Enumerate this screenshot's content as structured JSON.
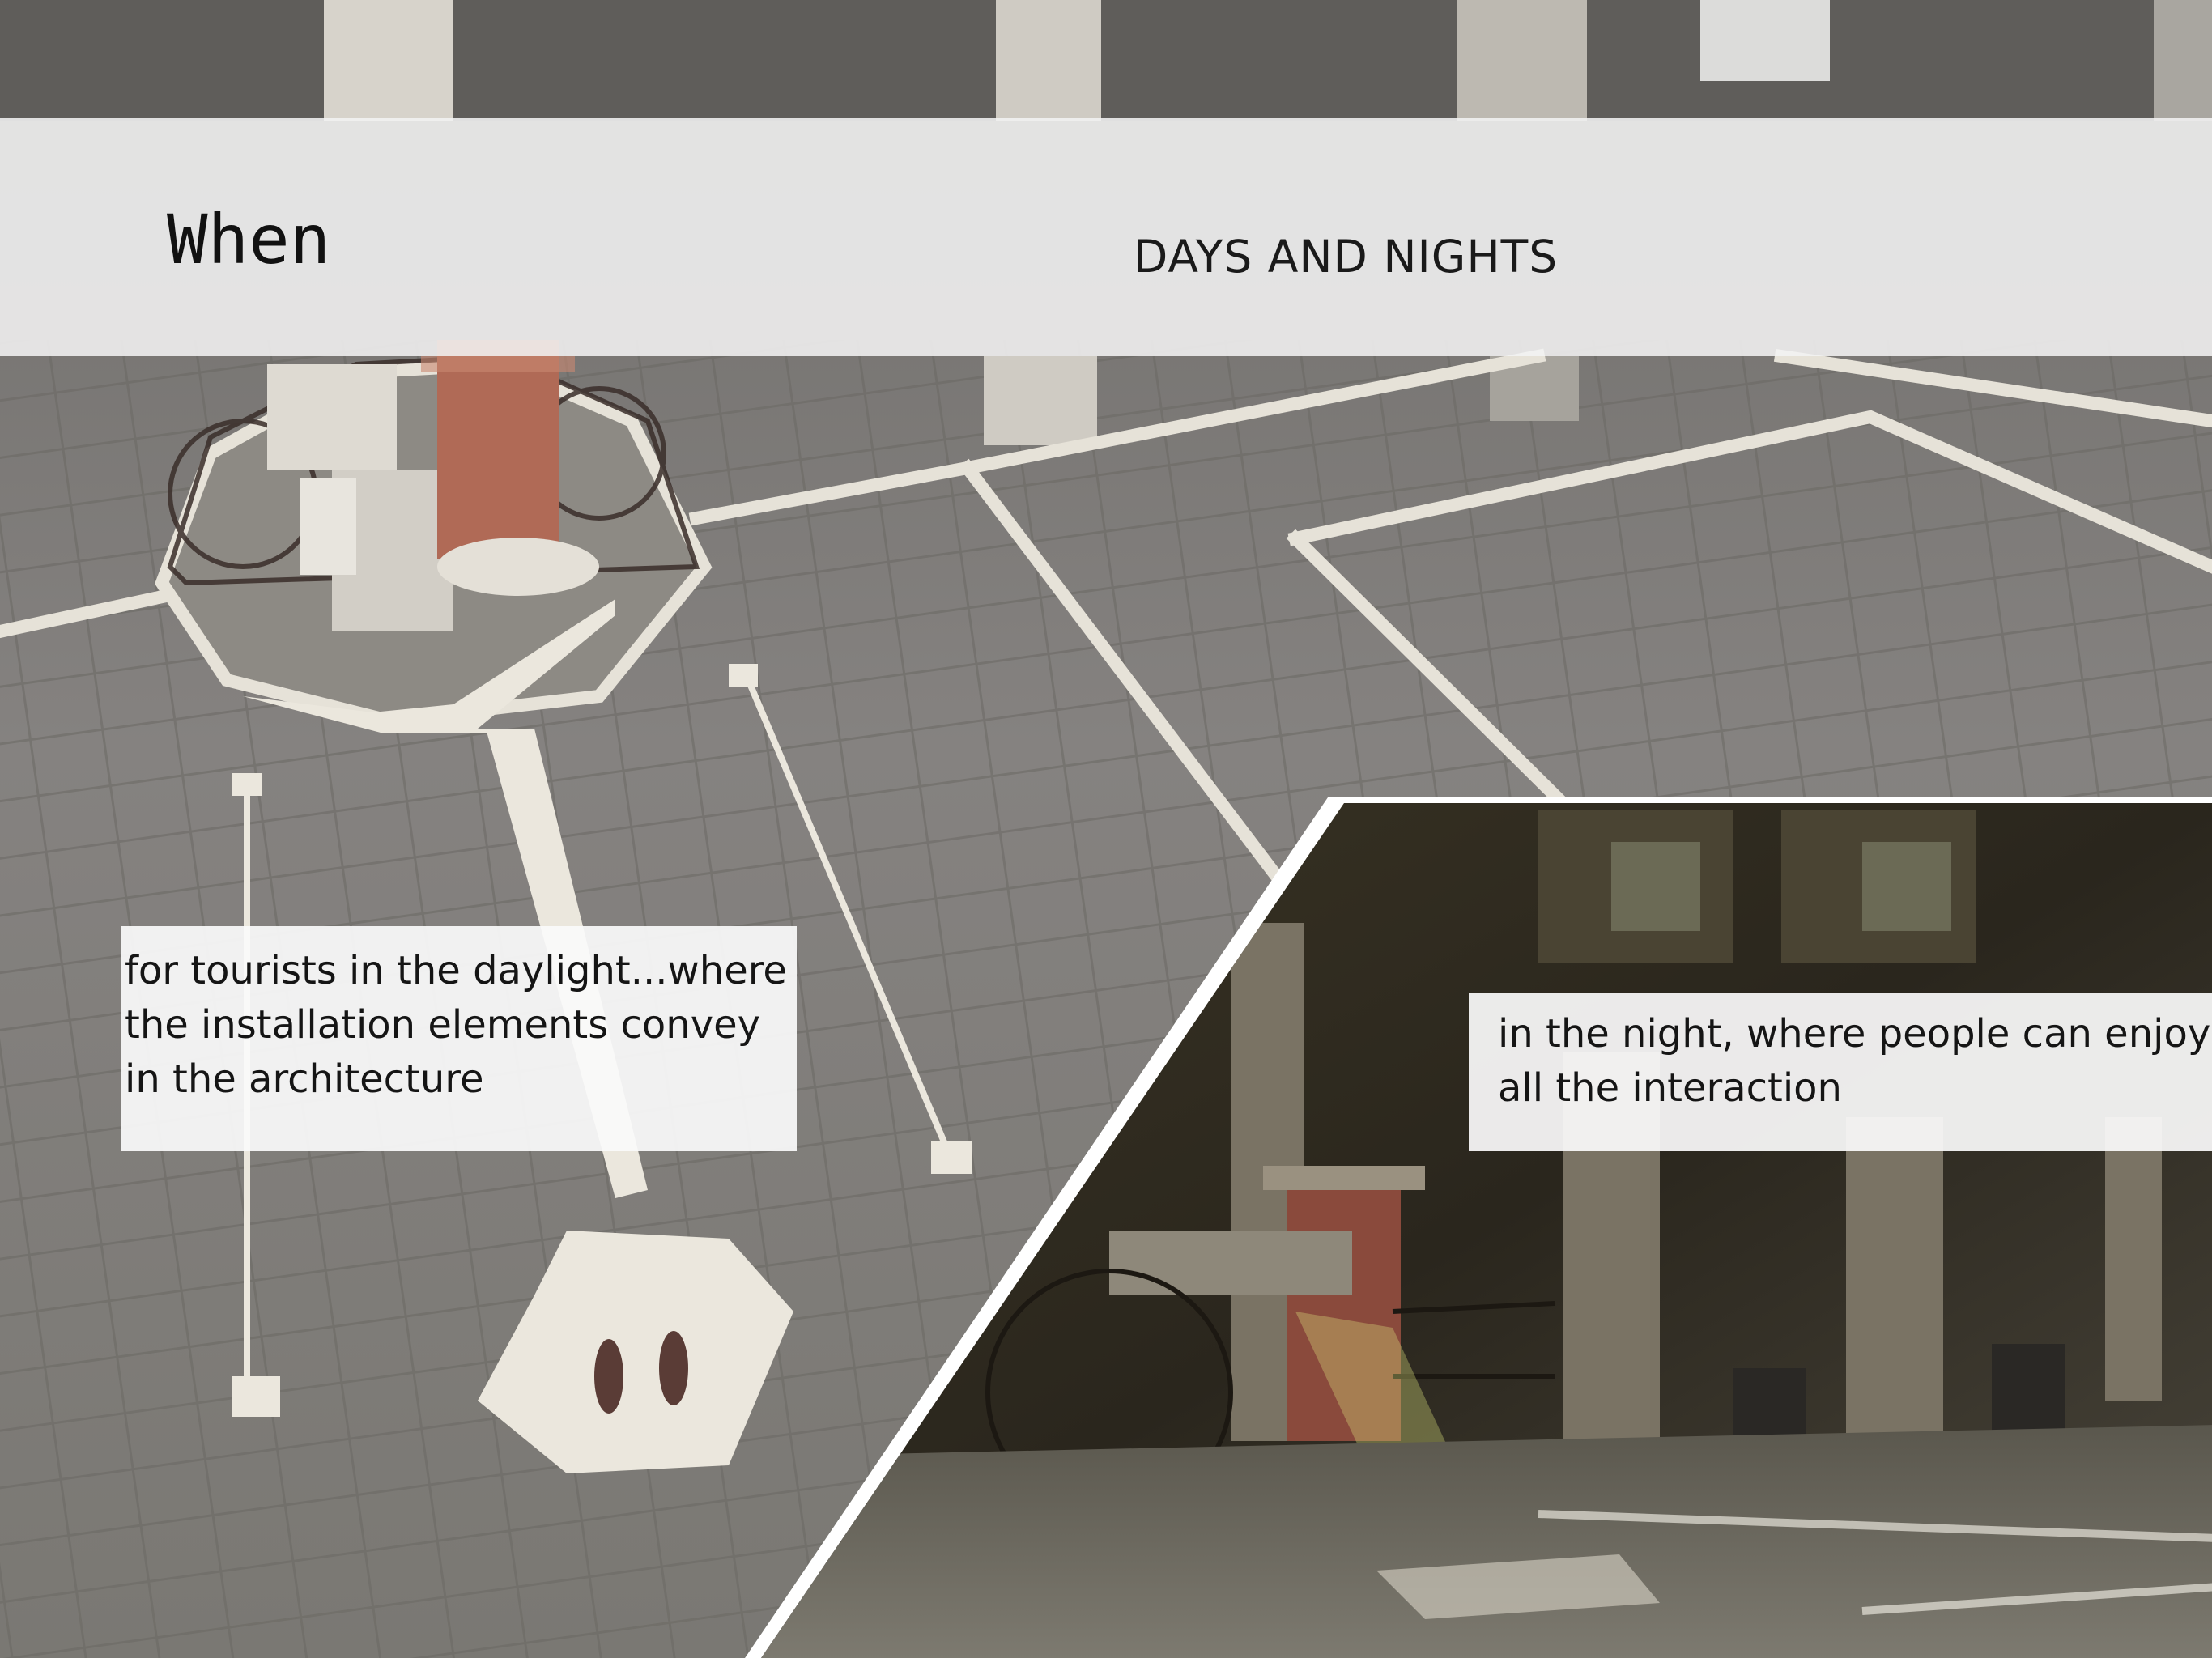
{
  "slide": {
    "title": "When",
    "subtitle": "DAYS AND NIGHTS"
  },
  "captions": {
    "day": "for tourists in the daylight...where the installation elements convey in the architecture",
    "night": "in the night, where people can enjoy all the interaction"
  },
  "colors": {
    "band": "#f2f2f2",
    "text": "#111111",
    "floor": "#807d78",
    "floor_lines": "#e9e6dc",
    "night_bg": "#2f2a1f"
  }
}
